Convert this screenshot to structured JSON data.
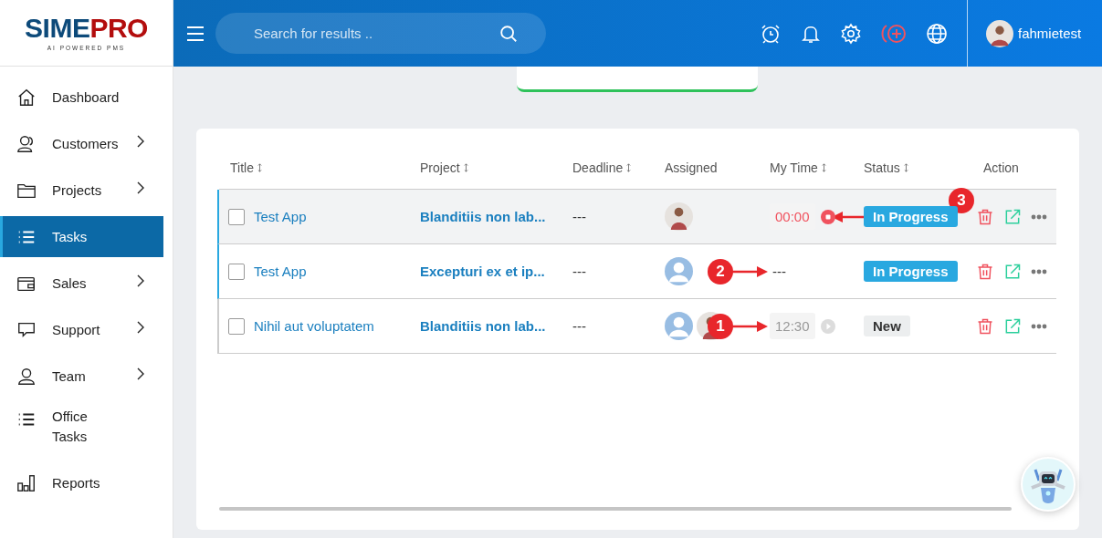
{
  "logo": {
    "primary": "SIME",
    "accent": "PRO",
    "tagline": "AI POWERED PMS"
  },
  "search": {
    "placeholder": "Search for results .."
  },
  "user": {
    "name": "fahmietest"
  },
  "sidebar": {
    "items": [
      {
        "label": "Dashboard",
        "kind": "home",
        "has_submenu": false,
        "selected": false
      },
      {
        "label": "Customers",
        "kind": "users",
        "has_submenu": true,
        "selected": false
      },
      {
        "label": "Projects",
        "kind": "folder",
        "has_submenu": true,
        "selected": false
      },
      {
        "label": "Tasks",
        "kind": "list",
        "has_submenu": false,
        "selected": true
      },
      {
        "label": "Sales",
        "kind": "wallet",
        "has_submenu": true,
        "selected": false
      },
      {
        "label": "Support",
        "kind": "chat",
        "has_submenu": true,
        "selected": false
      },
      {
        "label": "Team",
        "kind": "user",
        "has_submenu": true,
        "selected": false
      },
      {
        "label": "Office Tasks",
        "kind": "list",
        "has_submenu": false,
        "selected": false
      },
      {
        "label": "Reports",
        "kind": "chart",
        "has_submenu": false,
        "selected": false
      }
    ]
  },
  "table": {
    "columns": [
      {
        "label": "Title",
        "sortable": true
      },
      {
        "label": "Project",
        "sortable": true
      },
      {
        "label": "Deadline",
        "sortable": true
      },
      {
        "label": "Assigned",
        "sortable": false
      },
      {
        "label": "My Time",
        "sortable": true
      },
      {
        "label": "Status",
        "sortable": true
      },
      {
        "label": "Action",
        "sortable": false
      }
    ],
    "rows": [
      {
        "color": "#29a8e0",
        "highlighted": true,
        "checked": false,
        "title": "Test App",
        "project": "Blanditiis non lab...",
        "deadline": "---",
        "assigned": [
          {
            "kind": "photo"
          }
        ],
        "timer": {
          "kind": "running",
          "text": "00:00"
        },
        "status": {
          "kind": "in_progress",
          "label": "In Progress"
        },
        "annotation": {
          "kind": "arrow_left",
          "number": "3"
        }
      },
      {
        "color": "#29a8e0",
        "highlighted": false,
        "checked": false,
        "title": "Test App",
        "project": "Excepturi ex et ip...",
        "deadline": "---",
        "assigned": [
          {
            "kind": "placeholder"
          }
        ],
        "timer": {
          "kind": "none",
          "text": "---"
        },
        "status": {
          "kind": "in_progress",
          "label": "In Progress"
        },
        "annotation": {
          "kind": "arrow_right",
          "number": "2"
        }
      },
      {
        "color": "#cccccc",
        "highlighted": false,
        "checked": false,
        "title": "Nihil aut voluptatem",
        "project": "Blanditiis non lab...",
        "deadline": "---",
        "assigned": [
          {
            "kind": "placeholder"
          },
          {
            "kind": "photo"
          }
        ],
        "timer": {
          "kind": "paused",
          "text": "12:30"
        },
        "status": {
          "kind": "new",
          "label": "New"
        },
        "annotation": {
          "kind": "arrow_right",
          "number": "1"
        }
      }
    ]
  }
}
